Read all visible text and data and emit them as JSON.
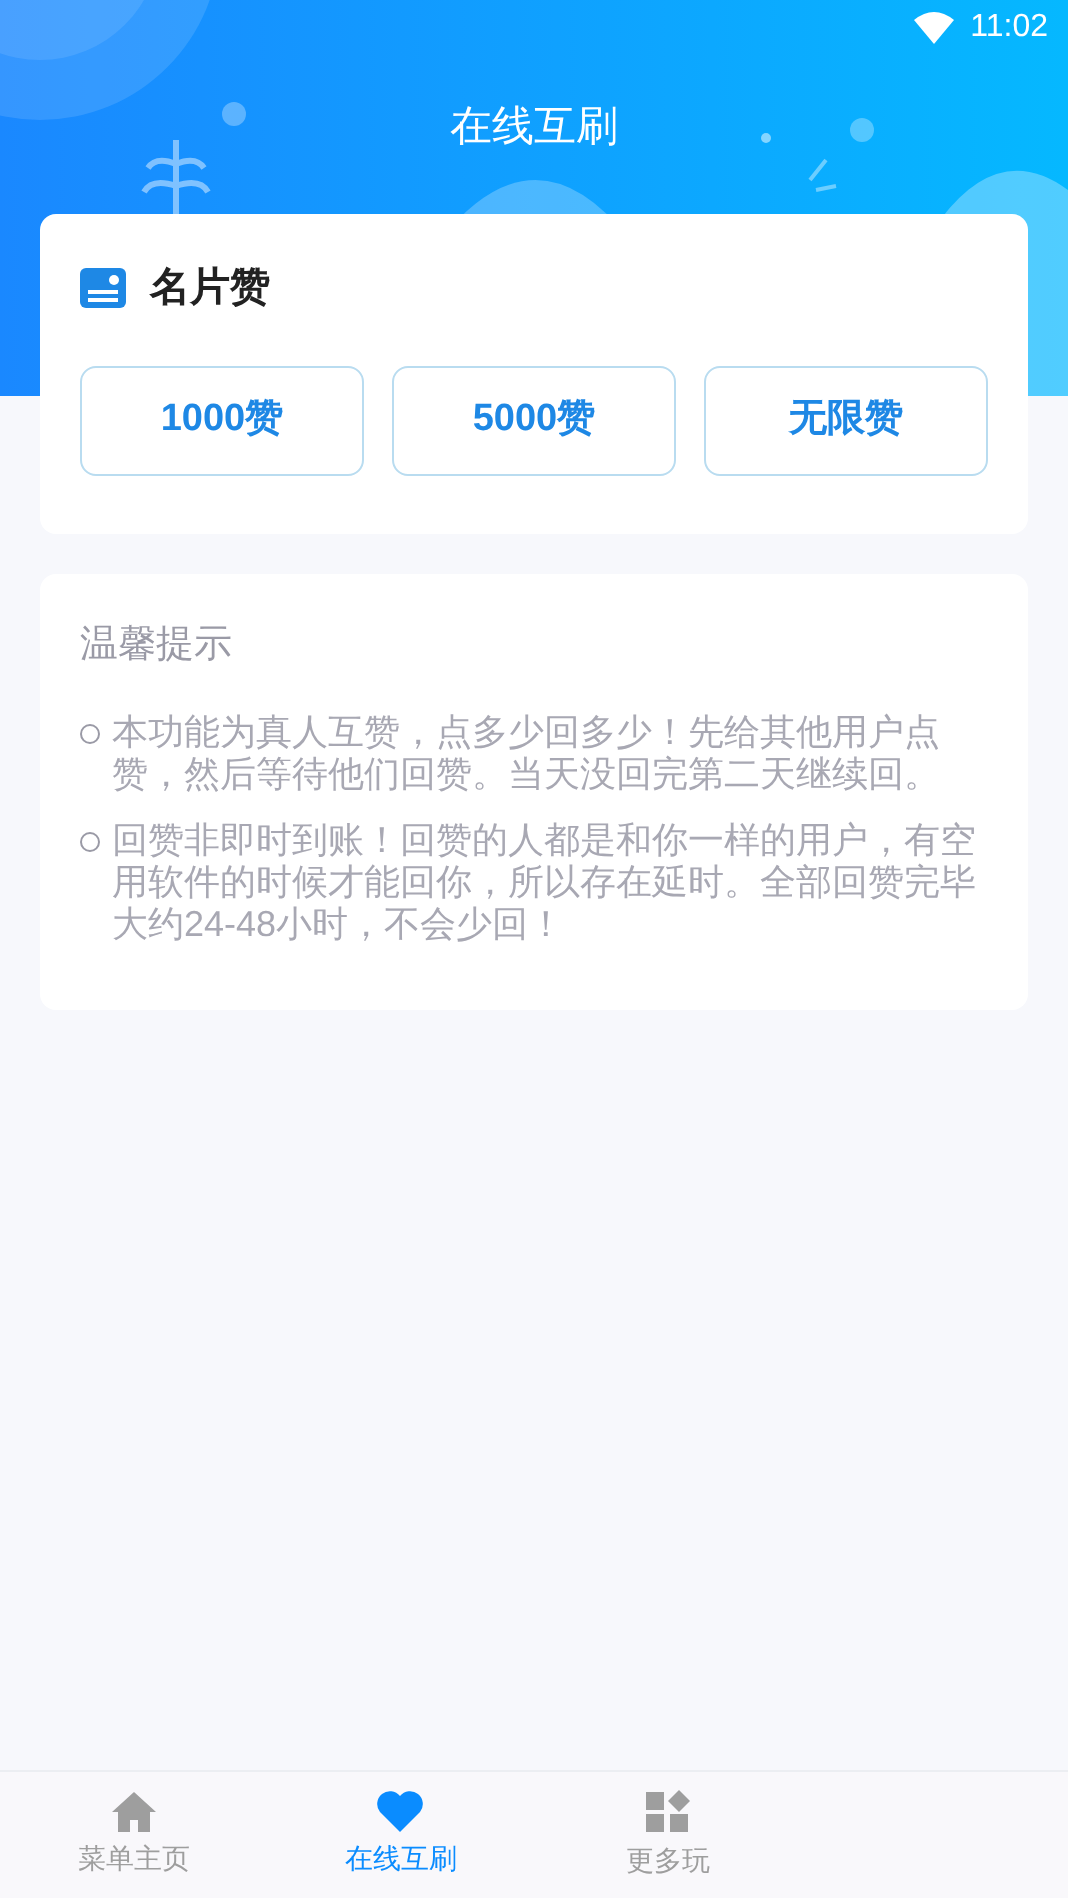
{
  "status_bar": {
    "time": "11:02"
  },
  "title": "在线互刷",
  "card": {
    "title": "名片赞",
    "buttons": [
      "1000赞",
      "5000赞",
      "无限赞"
    ]
  },
  "tips": {
    "title": "温馨提示",
    "items": [
      "本功能为真人互赞，点多少回多少！先给其他用户点赞，然后等待他们回赞。当天没回完第二天继续回。",
      "回赞非即时到账！回赞的人都是和你一样的用户，有空用软件的时候才能回你，所以存在延时。全部回赞完毕大约24-48小时，不会少回！"
    ]
  },
  "nav": [
    {
      "label": "菜单主页",
      "kind": "home",
      "selected": false
    },
    {
      "label": "在线互刷",
      "kind": "heart",
      "selected": true
    },
    {
      "label": "更多玩",
      "kind": "grid",
      "selected": false
    }
  ]
}
